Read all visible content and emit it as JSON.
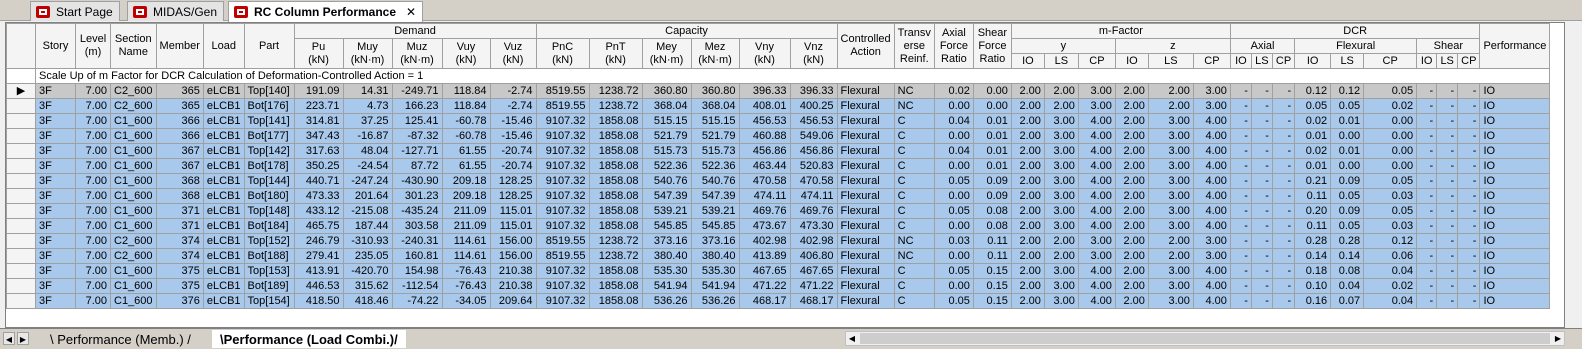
{
  "tabs": [
    {
      "label": "Start Page",
      "active": false
    },
    {
      "label": "MIDAS/Gen",
      "active": false
    },
    {
      "label": "RC Column Performance",
      "active": true
    }
  ],
  "headers": {
    "story": "Story",
    "level": "Level (m)",
    "section": "Section Name",
    "member": "Member",
    "load": "Load",
    "part": "Part",
    "demand": "Demand",
    "capacity": "Capacity",
    "controlled": "Controlled Action",
    "transverse": "Transv erse Reinf.",
    "axial_ratio": "Axial Force Ratio",
    "shear_ratio": "Shear Force Ratio",
    "mfactor": "m-Factor",
    "dcr": "DCR",
    "performance": "Performance",
    "demand_cols": [
      [
        "Pu",
        "(kN)"
      ],
      [
        "Muy",
        "(kN·m)"
      ],
      [
        "Muz",
        "(kN·m)"
      ],
      [
        "Vuy",
        "(kN)"
      ],
      [
        "Vuz",
        "(kN)"
      ]
    ],
    "capacity_cols": [
      [
        "PnC",
        "(kN)"
      ],
      [
        "PnT",
        "(kN)"
      ],
      [
        "Mey",
        "(kN·m)"
      ],
      [
        "Mez",
        "(kN·m)"
      ],
      [
        "Vny",
        "(kN)"
      ],
      [
        "Vnz",
        "(kN)"
      ]
    ],
    "mfactor_groups": [
      "y",
      "z"
    ],
    "dcr_groups": [
      "Axial",
      "Flexural",
      "Shear"
    ],
    "levels": [
      "IO",
      "LS",
      "CP"
    ]
  },
  "scale_note": "Scale Up of m Factor for DCR Calculation of Deformation-Controlled Action = 1",
  "rows": [
    [
      "3F",
      "7.00",
      "C2_600",
      "365",
      "eLCB1",
      "Top[140]",
      "191.09",
      "14.31",
      "-249.71",
      "118.84",
      "-2.74",
      "8519.55",
      "1238.72",
      "360.80",
      "360.80",
      "396.33",
      "396.33",
      "Flexural",
      "NC",
      "0.02",
      "0.00",
      "2.00",
      "2.00",
      "3.00",
      "2.00",
      "2.00",
      "3.00",
      "-",
      "-",
      "-",
      "0.12",
      "0.12",
      "0.05",
      "-",
      "-",
      "-",
      "IO"
    ],
    [
      "3F",
      "7.00",
      "C2_600",
      "365",
      "eLCB1",
      "Bot[176]",
      "223.71",
      "4.73",
      "166.23",
      "118.84",
      "-2.74",
      "8519.55",
      "1238.72",
      "368.04",
      "368.04",
      "408.01",
      "400.25",
      "Flexural",
      "NC",
      "0.00",
      "0.00",
      "2.00",
      "2.00",
      "3.00",
      "2.00",
      "2.00",
      "3.00",
      "-",
      "-",
      "-",
      "0.05",
      "0.05",
      "0.02",
      "-",
      "-",
      "-",
      "IO"
    ],
    [
      "3F",
      "7.00",
      "C1_600",
      "366",
      "eLCB1",
      "Top[141]",
      "314.81",
      "37.25",
      "125.41",
      "-60.78",
      "-15.46",
      "9107.32",
      "1858.08",
      "515.15",
      "515.15",
      "456.53",
      "456.53",
      "Flexural",
      "C",
      "0.04",
      "0.01",
      "2.00",
      "3.00",
      "4.00",
      "2.00",
      "3.00",
      "4.00",
      "-",
      "-",
      "-",
      "0.02",
      "0.01",
      "0.00",
      "-",
      "-",
      "-",
      "IO"
    ],
    [
      "3F",
      "7.00",
      "C1_600",
      "366",
      "eLCB1",
      "Bot[177]",
      "347.43",
      "-16.87",
      "-87.32",
      "-60.78",
      "-15.46",
      "9107.32",
      "1858.08",
      "521.79",
      "521.79",
      "460.88",
      "549.06",
      "Flexural",
      "C",
      "0.00",
      "0.01",
      "2.00",
      "3.00",
      "4.00",
      "2.00",
      "3.00",
      "4.00",
      "-",
      "-",
      "-",
      "0.01",
      "0.00",
      "0.00",
      "-",
      "-",
      "-",
      "IO"
    ],
    [
      "3F",
      "7.00",
      "C1_600",
      "367",
      "eLCB1",
      "Top[142]",
      "317.63",
      "48.04",
      "-127.71",
      "61.55",
      "-20.74",
      "9107.32",
      "1858.08",
      "515.73",
      "515.73",
      "456.86",
      "456.86",
      "Flexural",
      "C",
      "0.04",
      "0.01",
      "2.00",
      "3.00",
      "4.00",
      "2.00",
      "3.00",
      "4.00",
      "-",
      "-",
      "-",
      "0.02",
      "0.01",
      "0.00",
      "-",
      "-",
      "-",
      "IO"
    ],
    [
      "3F",
      "7.00",
      "C1_600",
      "367",
      "eLCB1",
      "Bot[178]",
      "350.25",
      "-24.54",
      "87.72",
      "61.55",
      "-20.74",
      "9107.32",
      "1858.08",
      "522.36",
      "522.36",
      "463.44",
      "520.83",
      "Flexural",
      "C",
      "0.00",
      "0.01",
      "2.00",
      "3.00",
      "4.00",
      "2.00",
      "3.00",
      "4.00",
      "-",
      "-",
      "-",
      "0.01",
      "0.00",
      "0.00",
      "-",
      "-",
      "-",
      "IO"
    ],
    [
      "3F",
      "7.00",
      "C1_600",
      "368",
      "eLCB1",
      "Top[144]",
      "440.71",
      "-247.24",
      "-430.90",
      "209.18",
      "128.25",
      "9107.32",
      "1858.08",
      "540.76",
      "540.76",
      "470.58",
      "470.58",
      "Flexural",
      "C",
      "0.05",
      "0.09",
      "2.00",
      "3.00",
      "4.00",
      "2.00",
      "3.00",
      "4.00",
      "-",
      "-",
      "-",
      "0.21",
      "0.09",
      "0.05",
      "-",
      "-",
      "-",
      "IO"
    ],
    [
      "3F",
      "7.00",
      "C1_600",
      "368",
      "eLCB1",
      "Bot[180]",
      "473.33",
      "201.64",
      "301.23",
      "209.18",
      "128.25",
      "9107.32",
      "1858.08",
      "547.39",
      "547.39",
      "474.11",
      "474.11",
      "Flexural",
      "C",
      "0.00",
      "0.09",
      "2.00",
      "3.00",
      "4.00",
      "2.00",
      "3.00",
      "4.00",
      "-",
      "-",
      "-",
      "0.11",
      "0.05",
      "0.03",
      "-",
      "-",
      "-",
      "IO"
    ],
    [
      "3F",
      "7.00",
      "C1_600",
      "371",
      "eLCB1",
      "Top[148]",
      "433.12",
      "-215.08",
      "-435.24",
      "211.09",
      "115.01",
      "9107.32",
      "1858.08",
      "539.21",
      "539.21",
      "469.76",
      "469.76",
      "Flexural",
      "C",
      "0.05",
      "0.08",
      "2.00",
      "3.00",
      "4.00",
      "2.00",
      "3.00",
      "4.00",
      "-",
      "-",
      "-",
      "0.20",
      "0.09",
      "0.05",
      "-",
      "-",
      "-",
      "IO"
    ],
    [
      "3F",
      "7.00",
      "C1_600",
      "371",
      "eLCB1",
      "Bot[184]",
      "465.75",
      "187.44",
      "303.58",
      "211.09",
      "115.01",
      "9107.32",
      "1858.08",
      "545.85",
      "545.85",
      "473.67",
      "473.30",
      "Flexural",
      "C",
      "0.00",
      "0.08",
      "2.00",
      "3.00",
      "4.00",
      "2.00",
      "3.00",
      "4.00",
      "-",
      "-",
      "-",
      "0.11",
      "0.05",
      "0.03",
      "-",
      "-",
      "-",
      "IO"
    ],
    [
      "3F",
      "7.00",
      "C2_600",
      "374",
      "eLCB1",
      "Top[152]",
      "246.79",
      "-310.93",
      "-240.31",
      "114.61",
      "156.00",
      "8519.55",
      "1238.72",
      "373.16",
      "373.16",
      "402.98",
      "402.98",
      "Flexural",
      "NC",
      "0.03",
      "0.11",
      "2.00",
      "2.00",
      "3.00",
      "2.00",
      "2.00",
      "3.00",
      "-",
      "-",
      "-",
      "0.28",
      "0.28",
      "0.12",
      "-",
      "-",
      "-",
      "IO"
    ],
    [
      "3F",
      "7.00",
      "C2_600",
      "374",
      "eLCB1",
      "Bot[188]",
      "279.41",
      "235.05",
      "160.81",
      "114.61",
      "156.00",
      "8519.55",
      "1238.72",
      "380.40",
      "380.40",
      "413.89",
      "406.80",
      "Flexural",
      "NC",
      "0.00",
      "0.11",
      "2.00",
      "2.00",
      "3.00",
      "2.00",
      "2.00",
      "3.00",
      "-",
      "-",
      "-",
      "0.14",
      "0.14",
      "0.06",
      "-",
      "-",
      "-",
      "IO"
    ],
    [
      "3F",
      "7.00",
      "C1_600",
      "375",
      "eLCB1",
      "Top[153]",
      "413.91",
      "-420.70",
      "154.98",
      "-76.43",
      "210.38",
      "9107.32",
      "1858.08",
      "535.30",
      "535.30",
      "467.65",
      "467.65",
      "Flexural",
      "C",
      "0.05",
      "0.15",
      "2.00",
      "3.00",
      "4.00",
      "2.00",
      "3.00",
      "4.00",
      "-",
      "-",
      "-",
      "0.18",
      "0.08",
      "0.04",
      "-",
      "-",
      "-",
      "IO"
    ],
    [
      "3F",
      "7.00",
      "C1_600",
      "375",
      "eLCB1",
      "Bot[189]",
      "446.53",
      "315.62",
      "-112.54",
      "-76.43",
      "210.38",
      "9107.32",
      "1858.08",
      "541.94",
      "541.94",
      "471.22",
      "471.22",
      "Flexural",
      "C",
      "0.00",
      "0.15",
      "2.00",
      "3.00",
      "4.00",
      "2.00",
      "3.00",
      "4.00",
      "-",
      "-",
      "-",
      "0.10",
      "0.04",
      "0.02",
      "-",
      "-",
      "-",
      "IO"
    ],
    [
      "3F",
      "7.00",
      "C1_600",
      "376",
      "eLCB1",
      "Top[154]",
      "418.50",
      "418.46",
      "-74.22",
      "-34.05",
      "209.64",
      "9107.32",
      "1858.08",
      "536.26",
      "536.26",
      "468.17",
      "468.17",
      "Flexural",
      "C",
      "0.05",
      "0.15",
      "2.00",
      "3.00",
      "4.00",
      "2.00",
      "3.00",
      "4.00",
      "-",
      "-",
      "-",
      "0.16",
      "0.07",
      "0.04",
      "-",
      "-",
      "-",
      "IO"
    ]
  ],
  "bottom": {
    "sheet_tabs": [
      "Performance (Memb.)",
      "Performance (Load Combi.)"
    ],
    "active_sheet": 1
  }
}
